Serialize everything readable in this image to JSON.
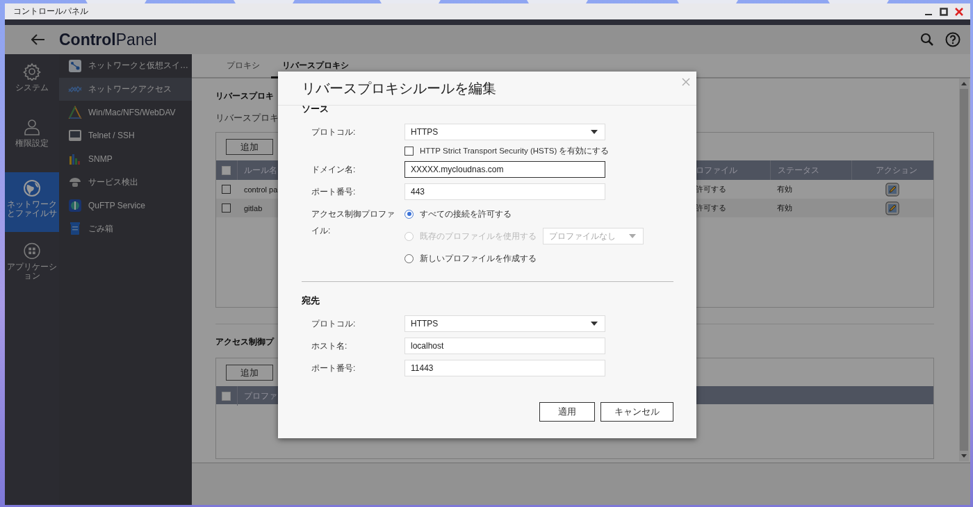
{
  "window": {
    "title": "コントロールパネル"
  },
  "header": {
    "title": "**Control**Panel"
  },
  "rail": [
    {
      "kind": "gear",
      "label": "システム",
      "selected": false
    },
    {
      "kind": "person",
      "label": "権限設定",
      "selected": false
    },
    {
      "kind": "globe",
      "label": "ネットワークとファイルサ",
      "selected": true
    },
    {
      "kind": "apps",
      "label": "アプリケーション",
      "selected": false
    }
  ],
  "menu": [
    {
      "kind": "switch",
      "label": "ネットワークと仮想スイ…",
      "selected": false
    },
    {
      "kind": "access",
      "label": "ネットワークアクセス",
      "selected": true
    },
    {
      "kind": "share",
      "label": "Win/Mac/NFS/WebDAV",
      "selected": false
    },
    {
      "kind": "terminal",
      "label": "Telnet / SSH",
      "selected": false
    },
    {
      "kind": "chart",
      "label": "SNMP",
      "selected": false
    },
    {
      "kind": "discovery",
      "label": "サービス検出",
      "selected": false
    },
    {
      "kind": "ftp",
      "label": "QuFTP Service",
      "selected": false
    },
    {
      "kind": "trash",
      "label": "ごみ箱",
      "selected": false
    }
  ],
  "tabs": [
    {
      "label": "プロキシ",
      "selected": false
    },
    {
      "label": "リバースプロキシ",
      "selected": true
    }
  ],
  "reverse_proxy": {
    "heading": "リバースプロキ",
    "description": "リバースプロキ",
    "add_button": "追加",
    "header_checked": false,
    "columns": [
      "ルール名",
      "ロファイル",
      "ステータス",
      "アクション"
    ],
    "rows": [
      {
        "name": "control pa",
        "profile": "許可する",
        "status": "有効",
        "checked": false
      },
      {
        "name": "gitlab",
        "profile": "許可する",
        "status": "有効",
        "checked": false
      }
    ]
  },
  "access_control": {
    "heading": "アクセス制御プ",
    "add_button": "追加",
    "header_checked": false,
    "columns": [
      "プロファ"
    ]
  },
  "dialog": {
    "title": "リバースプロキシルールを編集",
    "sections": [
      {
        "heading": "ソース",
        "fields": [
          {
            "kind": "select",
            "label": "プロトコル:",
            "value": "HTTPS"
          },
          {
            "kind": "checkbox",
            "text": "HTTP Strict Transport Security (HSTS) を有効にする",
            "checked": false
          },
          {
            "kind": "text",
            "label": "ドメイン名:",
            "value": "XXXXX.mycloudnas.com",
            "focused": true
          },
          {
            "kind": "text",
            "label": "ポート番号:",
            "value": "443",
            "focused": false
          },
          {
            "kind": "radio",
            "label": "アクセス制御プロファイル:",
            "options": [
              {
                "text": "すべての接続を許可する",
                "selected": true,
                "disabled": false
              },
              {
                "text": "既存のプロファイルを使用する",
                "selected": false,
                "disabled": true,
                "select": "プロファイルなし"
              },
              {
                "text": "新しいプロファイルを作成する",
                "selected": false,
                "disabled": false
              }
            ]
          }
        ]
      },
      {
        "heading": "宛先",
        "fields": [
          {
            "kind": "select",
            "label": "プロトコル:",
            "value": "HTTPS"
          },
          {
            "kind": "text",
            "label": "ホスト名:",
            "value": "localhost",
            "focused": false
          },
          {
            "kind": "text",
            "label": "ポート番号:",
            "value": "11443",
            "focused": false
          }
        ]
      }
    ],
    "buttons": [
      "適用",
      "キャンセル"
    ]
  }
}
